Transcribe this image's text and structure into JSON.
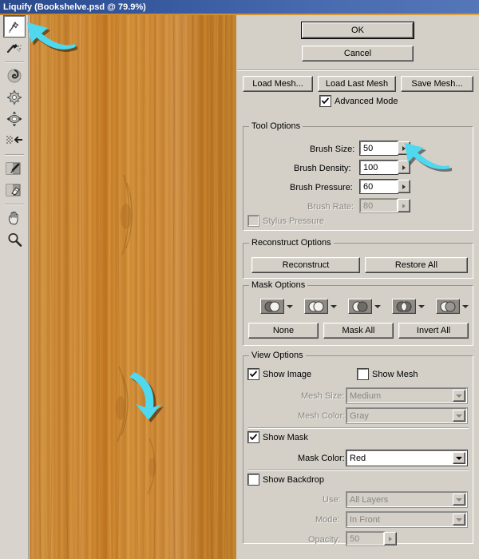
{
  "window": {
    "title": "Liquify (Bookshelve.psd @ 79.9%)"
  },
  "toolbar": {
    "tools": [
      {
        "name": "forward-warp-tool",
        "label": "Forward Warp Tool",
        "selected": true
      },
      {
        "name": "reconstruct-tool",
        "label": "Reconstruct Tool",
        "selected": false
      },
      {
        "name": "twirl-clockwise-tool",
        "label": "Twirl Clockwise Tool",
        "selected": false
      },
      {
        "name": "pucker-tool",
        "label": "Pucker Tool",
        "selected": false
      },
      {
        "name": "bloat-tool",
        "label": "Bloat Tool",
        "selected": false
      },
      {
        "name": "push-left-tool",
        "label": "Push Left Tool",
        "selected": false
      },
      {
        "name": "freeze-mask-tool",
        "label": "Freeze Mask Tool",
        "selected": false
      },
      {
        "name": "thaw-mask-tool",
        "label": "Thaw Mask Tool",
        "selected": false
      },
      {
        "name": "hand-tool",
        "label": "Hand Tool",
        "selected": false
      },
      {
        "name": "zoom-tool",
        "label": "Zoom Tool",
        "selected": false
      }
    ]
  },
  "buttons": {
    "ok": "OK",
    "cancel": "Cancel",
    "load_mesh": "Load Mesh...",
    "load_last_mesh": "Load Last Mesh",
    "save_mesh": "Save Mesh..."
  },
  "advanced_mode": {
    "label": "Advanced Mode",
    "checked": true
  },
  "tool_options": {
    "title": "Tool Options",
    "brush_size": {
      "label": "Brush Size:",
      "value": "50",
      "enabled": true
    },
    "brush_density": {
      "label": "Brush Density:",
      "value": "100",
      "enabled": true
    },
    "brush_pressure": {
      "label": "Brush Pressure:",
      "value": "60",
      "enabled": true
    },
    "brush_rate": {
      "label": "Brush Rate:",
      "value": "80",
      "enabled": false
    },
    "stylus_pressure": {
      "label": "Stylus Pressure",
      "checked": false,
      "enabled": false
    }
  },
  "reconstruct_options": {
    "title": "Reconstruct Options",
    "reconstruct": "Reconstruct",
    "restore_all": "Restore All"
  },
  "mask_options": {
    "title": "Mask Options",
    "mode_icons": [
      "mask-mode-replace-selection-icon",
      "mask-mode-add-to-selection-icon",
      "mask-mode-subtract-from-selection-icon",
      "mask-mode-intersect-with-selection-icon",
      "mask-mode-invert-selection-icon"
    ],
    "none": "None",
    "mask_all": "Mask All",
    "invert_all": "Invert All"
  },
  "view_options": {
    "title": "View Options",
    "show_image": {
      "label": "Show Image",
      "checked": true,
      "enabled": true
    },
    "show_mesh": {
      "label": "Show Mesh",
      "checked": false,
      "enabled": true
    },
    "mesh_size": {
      "label": "Mesh Size:",
      "value": "Medium",
      "enabled": false
    },
    "mesh_color": {
      "label": "Mesh Color:",
      "value": "Gray",
      "enabled": false
    },
    "show_mask": {
      "label": "Show Mask",
      "checked": true,
      "enabled": true
    },
    "mask_color": {
      "label": "Mask Color:",
      "value": "Red",
      "enabled": true
    },
    "show_backdrop": {
      "label": "Show Backdrop",
      "checked": false,
      "enabled": true
    },
    "use": {
      "label": "Use:",
      "value": "All Layers",
      "enabled": false
    },
    "mode": {
      "label": "Mode:",
      "value": "In Front",
      "enabled": false
    },
    "opacity": {
      "label": "Opacity:",
      "value": "50",
      "enabled": false
    }
  },
  "annotations": [
    {
      "name": "callout-arrow-forward-warp-tool",
      "direction": "up-left",
      "color": "#4fd8ee"
    },
    {
      "name": "callout-arrow-brush-density",
      "direction": "left",
      "color": "#4fd8ee"
    },
    {
      "name": "callout-arrow-canvas-warp-point",
      "direction": "down",
      "color": "#4fd8ee"
    }
  ],
  "colors": {
    "titlebar_start": "#2b4a8b",
    "titlebar_end": "#5477b8",
    "panel_bg": "#d4d0c8",
    "accent_cyan": "#4fd8ee",
    "wood": "#c87f24"
  }
}
